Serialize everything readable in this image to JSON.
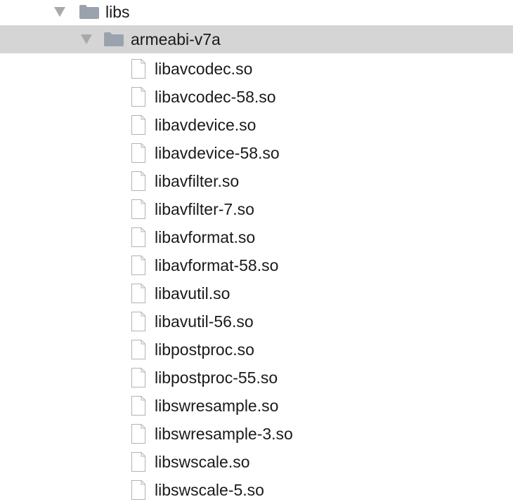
{
  "tree": {
    "root": {
      "label": "libs",
      "icon": "folder-icon",
      "expanded": true
    },
    "folder": {
      "label": "armeabi-v7a",
      "icon": "folder-icon",
      "expanded": true,
      "selected": true
    },
    "files": [
      {
        "label": "libavcodec.so"
      },
      {
        "label": "libavcodec-58.so"
      },
      {
        "label": "libavdevice.so"
      },
      {
        "label": "libavdevice-58.so"
      },
      {
        "label": "libavfilter.so"
      },
      {
        "label": "libavfilter-7.so"
      },
      {
        "label": "libavformat.so"
      },
      {
        "label": "libavformat-58.so"
      },
      {
        "label": "libavutil.so"
      },
      {
        "label": "libavutil-56.so"
      },
      {
        "label": "libpostproc.so"
      },
      {
        "label": "libpostproc-55.so"
      },
      {
        "label": "libswresample.so"
      },
      {
        "label": "libswresample-3.so"
      },
      {
        "label": "libswscale.so"
      },
      {
        "label": "libswscale-5.so"
      }
    ]
  },
  "colors": {
    "selection_background": "#d5d5d5",
    "folder_icon": "#9aa3ad",
    "arrow": "#a9a9a9",
    "text": "#1a1a1a"
  }
}
